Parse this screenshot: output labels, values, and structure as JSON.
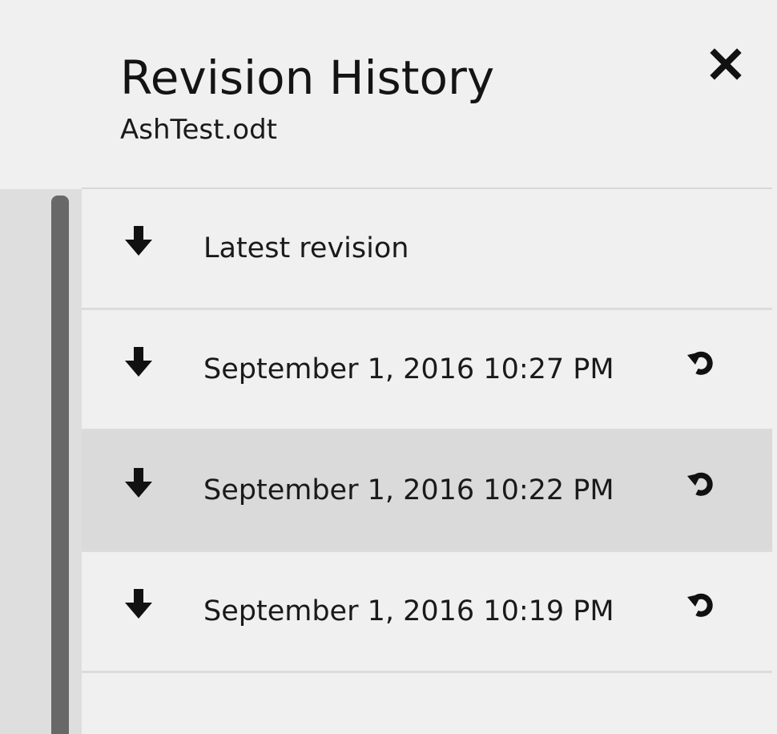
{
  "panel": {
    "title": "Revision History",
    "filename": "AshTest.odt"
  },
  "icons": {
    "close": "close-icon",
    "download": "arrow-down-icon",
    "restore": "restore-icon"
  },
  "revisions": [
    {
      "label": "Latest revision",
      "restorable": false,
      "selected": false
    },
    {
      "label": "September 1, 2016 10:27 PM",
      "restorable": true,
      "selected": false
    },
    {
      "label": "September 1, 2016 10:22 PM",
      "restorable": true,
      "selected": true
    },
    {
      "label": "September 1, 2016 10:19 PM",
      "restorable": true,
      "selected": false
    }
  ],
  "colors": {
    "background": "#f0f0f0",
    "selected_row": "#dadada",
    "divider": "#dcdcdc",
    "scrollbar": "#686868"
  }
}
